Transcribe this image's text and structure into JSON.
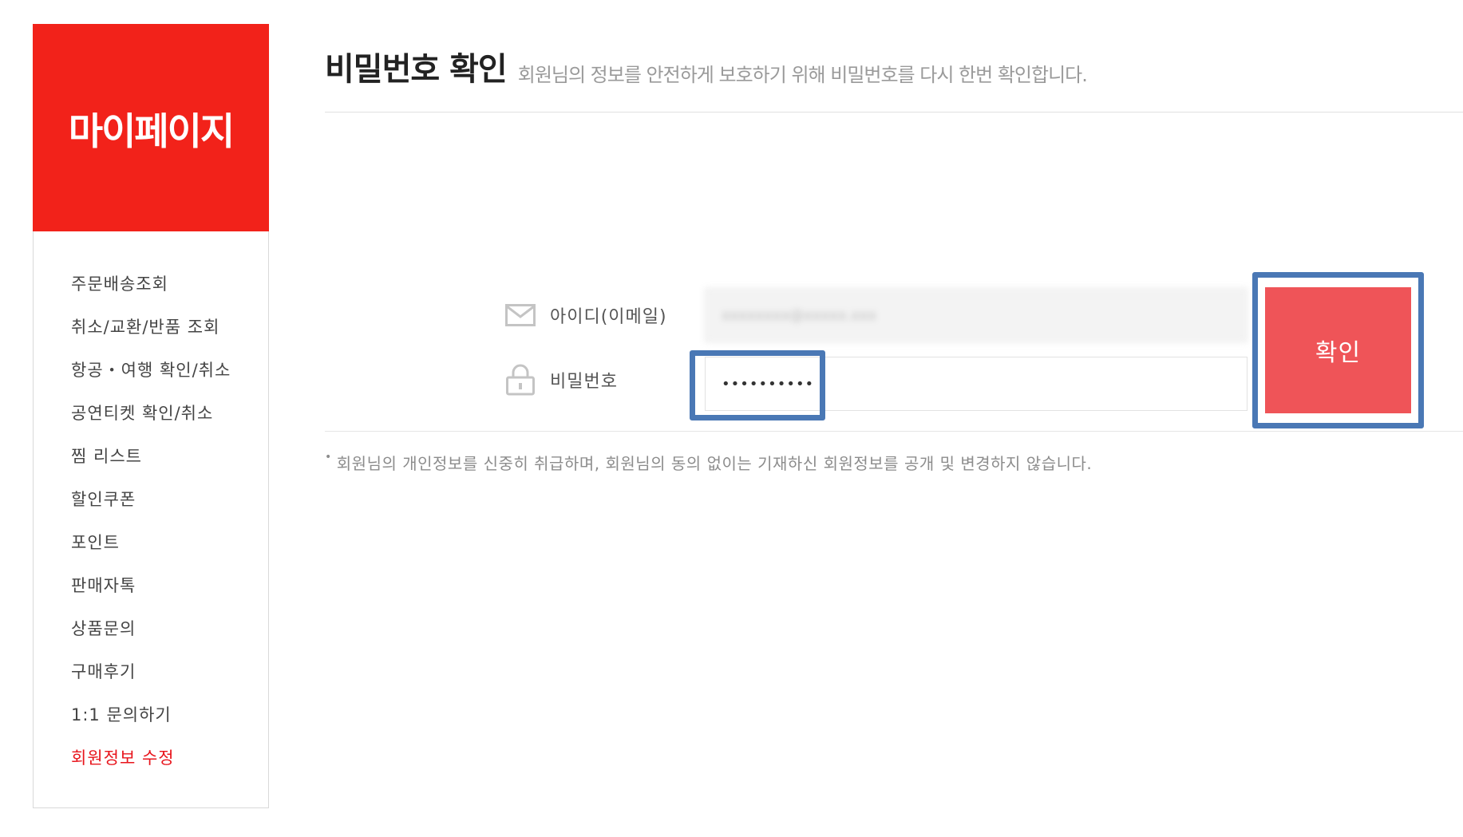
{
  "sidebar": {
    "title": "마이페이지",
    "items": [
      {
        "label": "주문배송조회",
        "active": false
      },
      {
        "label": "취소/교환/반품 조회",
        "active": false
      },
      {
        "label": "항공・여행 확인/취소",
        "active": false
      },
      {
        "label": "공연티켓 확인/취소",
        "active": false
      },
      {
        "label": "찜 리스트",
        "active": false
      },
      {
        "label": "할인쿠폰",
        "active": false
      },
      {
        "label": "포인트",
        "active": false
      },
      {
        "label": "판매자톡",
        "active": false
      },
      {
        "label": "상품문의",
        "active": false
      },
      {
        "label": "구매후기",
        "active": false
      },
      {
        "label": "1:1 문의하기",
        "active": false
      },
      {
        "label": "회원정보 수정",
        "active": true
      }
    ]
  },
  "header": {
    "title": "비밀번호 확인",
    "description": "회원님의 정보를 안전하게 보호하기 위해 비밀번호를 다시 한번 확인합니다."
  },
  "form": {
    "id_label": "아이디(이메일)",
    "id_value": "xxxxxxxx@xxxxx.xxx",
    "pw_label": "비밀번호",
    "pw_value": "••••••••••",
    "confirm_label": "확인"
  },
  "notice": "회원님의 개인정보를 신중히 취급하며, 회원님의 동의 없이는 기재하신 회원정보를 공개 및 변경하지 않습니다.",
  "colors": {
    "brand": "#f2221a",
    "button": "#ef5458",
    "highlight": "#4a78b5",
    "active_menu": "#e8141b"
  }
}
